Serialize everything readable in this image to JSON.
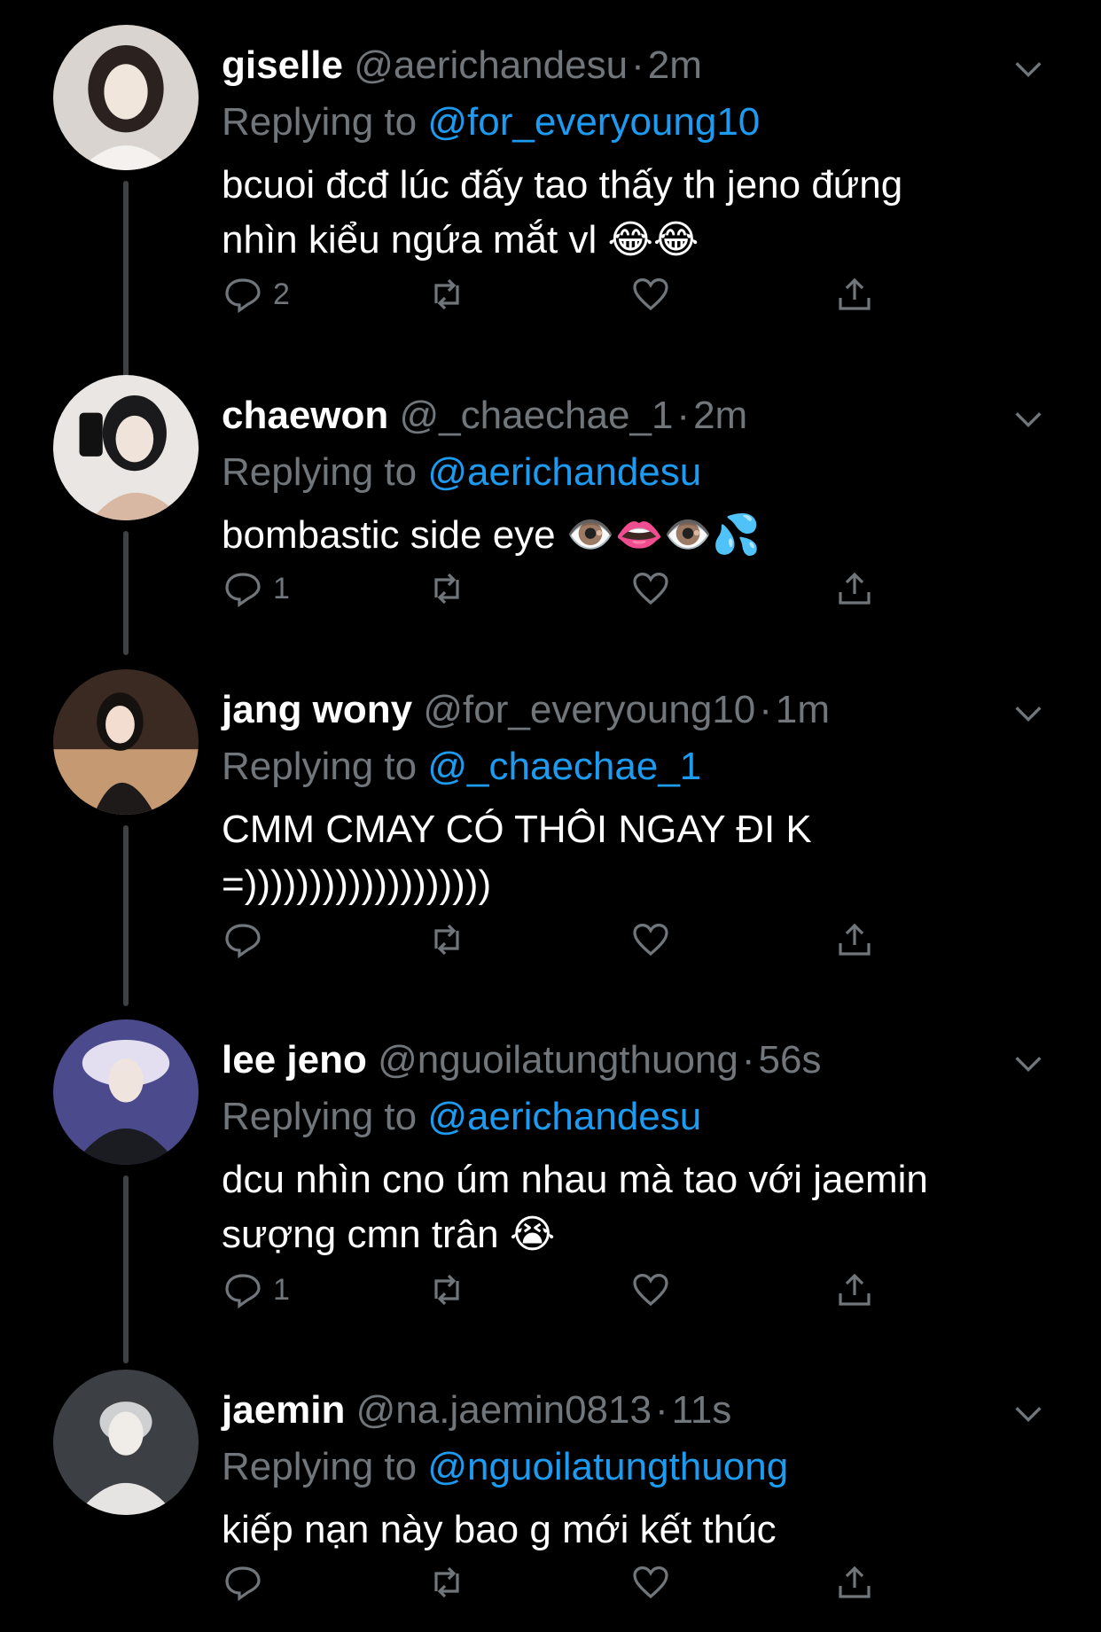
{
  "theme": {
    "background": "#000000",
    "text": "#ffffff",
    "muted": "#71767b",
    "accent": "#1d9bf0",
    "line": "#3e4144"
  },
  "replying_prefix": "Replying to",
  "tweets": [
    {
      "name": "giselle",
      "handle": "@aerichandesu",
      "separator": "·",
      "time": "2m",
      "replying_to": "@for_everyoung10",
      "text": "bcuoi đcđ lúc đấy tao thấy th jeno đứng\nnhìn kiểu ngứa mắt vl 😂😂",
      "reply_count": "2",
      "avatar_colors": [
        "#d9d4cf",
        "#2b2220",
        "#f1e6dc"
      ]
    },
    {
      "name": "chaewon",
      "handle": "@_chaechae_1",
      "separator": "·",
      "time": "2m",
      "replying_to": "@aerichandesu",
      "text": "bombastic side eye 👁️👄👁️💦",
      "reply_count": "1",
      "avatar_colors": [
        "#e9e6e3",
        "#1a1a1c",
        "#d8b8a3"
      ]
    },
    {
      "name": "jang wony",
      "handle": "@for_everyoung10",
      "separator": "·",
      "time": "1m",
      "replying_to": "@_chaechae_1",
      "text": "CMM CMAY CÓ THÔI NGAY ĐI K\n=)))))))))))))))))))",
      "reply_count": "",
      "avatar_colors": [
        "#3a2a22",
        "#c59a72",
        "#f3ddd0"
      ]
    },
    {
      "name": "lee jeno",
      "handle": "@nguoilatungthuong",
      "separator": "·",
      "time": "56s",
      "replying_to": "@aerichandesu",
      "text": "dcu nhìn cno úm nhau mà tao với jaemin\nsượng cmn trân 😭",
      "reply_count": "1",
      "avatar_colors": [
        "#4b4a8c",
        "#1b1b22",
        "#e3dff0"
      ]
    },
    {
      "name": "jaemin",
      "handle": "@na.jaemin0813",
      "separator": "·",
      "time": "11s",
      "replying_to": "@nguoilatungthuong",
      "text": "kiếp nạn này bao g mới kết thúc",
      "reply_count": "",
      "avatar_colors": [
        "#3c3f44",
        "#cfd0d2",
        "#f0ece8"
      ]
    }
  ],
  "icons": {
    "reply": "reply-icon",
    "retweet": "retweet-icon",
    "like": "heart-icon",
    "share": "share-icon",
    "menu": "chevron-down-icon"
  }
}
